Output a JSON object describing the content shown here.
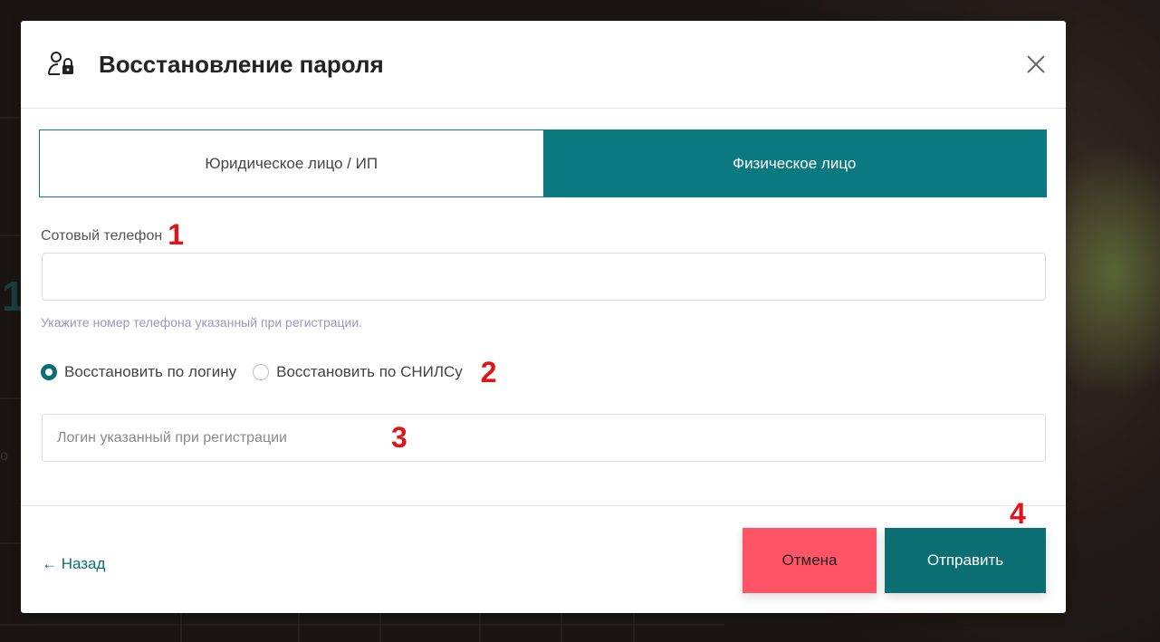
{
  "modal": {
    "title": "Восстановление пароля",
    "icon": "user-lock-icon",
    "close_icon": "close-icon"
  },
  "tabs": [
    {
      "label": "Юридическое лицо / ИП",
      "active": false
    },
    {
      "label": "Физическое лицо",
      "active": true
    }
  ],
  "phone": {
    "label": "Сотовый телефон",
    "value": "",
    "hint": "Укажите номер телефона указанный при регистрации."
  },
  "recovery_mode": {
    "options": [
      {
        "label": "Восстановить по логину",
        "checked": true
      },
      {
        "label": "Восстановить по СНИЛСу",
        "checked": false
      }
    ]
  },
  "login": {
    "placeholder": "Логин указанный при регистрации",
    "value": ""
  },
  "footer": {
    "back_label": "← Назад",
    "cancel_label": "Отмена",
    "submit_label": "Отправить"
  },
  "annotations": {
    "m1": "1",
    "m2": "2",
    "m3": "3",
    "m4": "4"
  },
  "background": {
    "left_large_char": "1",
    "left_small_text": "о"
  },
  "colors": {
    "accent": "#0b6e73",
    "cancel": "#ff5567",
    "hint": "#9b95c4",
    "marker": "#e0151a"
  }
}
